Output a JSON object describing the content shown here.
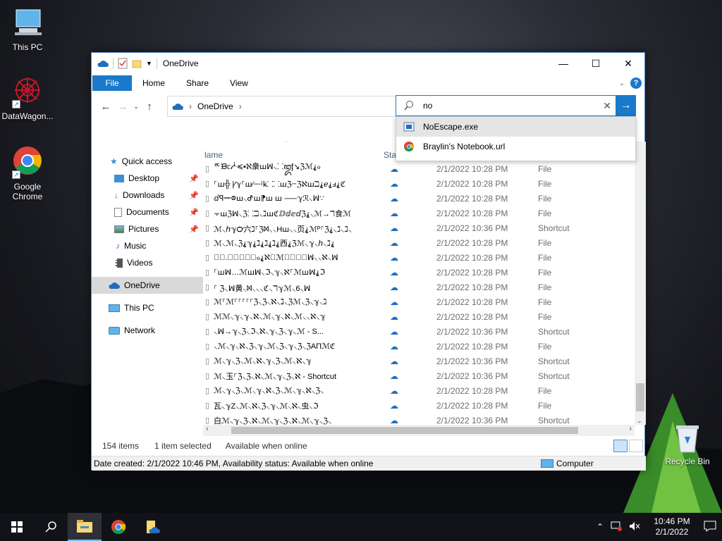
{
  "desktop": {
    "icons": [
      {
        "label": "This PC",
        "icon": "computer-icon"
      },
      {
        "label": "DataWagon...",
        "icon": "mandala-app-icon"
      },
      {
        "label": "Google Chrome",
        "icon": "chrome-icon"
      },
      {
        "label": "Recycle Bin",
        "icon": "recycle-bin-icon"
      }
    ]
  },
  "window": {
    "title": "OneDrive",
    "ribbon_tabs": [
      "File",
      "Home",
      "Share",
      "View"
    ],
    "address": {
      "location": "OneDrive"
    },
    "search": {
      "value": "no"
    },
    "suggestions": [
      {
        "label": "NoEscape.exe",
        "icon": "exe-icon"
      },
      {
        "label": "Braylin's Notebook.url",
        "icon": "chrome-icon"
      }
    ],
    "nav": {
      "quick_access": "Quick access",
      "items": [
        "Desktop",
        "Downloads",
        "Documents",
        "Pictures",
        "Music",
        "Videos"
      ],
      "onedrive": "OneDrive",
      "this_pc": "This PC",
      "network": "Network"
    },
    "columns": {
      "name": "lame",
      "status": "Stal"
    },
    "files": [
      {
        "name": "ꥦᙖᥴᓿ≼▪ℵ衆ꟺꟽ⸜⸬ꦈᶂ↘ℨℳ⸘ℴ",
        "date": "2/1/2022 10:28 PM",
        "type": "File"
      },
      {
        "name": "⸀ꟺ╬ |⁄ℽ⸀ꟺ⁄ᅳꜟꝃ⸬⸬ꟺℨⵈℨℵꟺℶ⸘ℯ⸘ⅎ⸘ℭ",
        "date": "2/1/2022 10:28 PM",
        "type": "File"
      },
      {
        "name": "ⅆꟼᆖ᳂ꟺ⸜ᕷꟺ⁋ꟺ ꟺ ⸺ℽℛ⸜ꟽ∵",
        "date": "2/1/2022 10:28 PM",
        "type": "File"
      },
      {
        "name": "⸟ꟺℨꟽ⸜ℨ⸬ℶ⸜ℷꟺℭⅅⅆⅇⅆℨ⸘⸜ℳ→ℸ食ℳ",
        "date": "2/1/2022 10:28 PM",
        "type": "File"
      },
      {
        "name": "ℳ⸜ℎℽ℺六ℷ⸀ℨᢂ⸜⸜Hꟺ⸜⸜页⸘ℳᴾ⸀ℨ⸘⸜ℷ⸜ℷ⸜",
        "date": "2/1/2022 10:36 PM",
        "type": "Shortcut"
      },
      {
        "name": "ℳ⸜ℳ⸜ℨ⸘ℽ⸘ℷ⸘ℷ⸘ℷ⸘西⸘ℨℳ⸜ℽ⸜ℎ⸜ℷ⸘",
        "date": "2/1/2022 10:28 PM",
        "type": "File"
      },
      {
        "name": "⸀⸀.⸀⸀⸜ꦿ⸜ℴ⸘ℵ⸀ℳ⸜⸜⸜⸜ꟽ⸜⸜ℵ⸜ꟽ",
        "date": "2/1/2022 10:28 PM",
        "type": "File"
      },
      {
        "name": "⸀ꟺꟽ…ℳꟺꟽ⸜ℑ⸜ℽ⸜ℵ⸀ℳꟺꟽ⸘ℑ",
        "date": "2/1/2022 10:28 PM",
        "type": "File"
      },
      {
        "name": "⸀ ℨ⸜ꟽ黄⸜ᢂ⸜⸜⸜ℭ⸜ℸℽℳ⸜6⸜ꟽ",
        "date": "2/1/2022 10:28 PM",
        "type": "File"
      },
      {
        "name": "ℳ⸀ℳ⸀⸀⸀⸀⸀ℨ⸜ℨ⸜ℵ⸜ℷ⸜ℨℳ⸜ℨ⸜ℽ⸜ℷ",
        "date": "2/1/2022 10:28 PM",
        "type": "File"
      },
      {
        "name": "ℳℳ⸜ℽ⸜ℽ⸜ℵ⸜ℳ⸜ℽ⸜ℵ⸜ℳ⸜⸜ℵ⸜ℽ",
        "date": "2/1/2022 10:28 PM",
        "type": "File"
      },
      {
        "name": "⸜ꟽ→ℽ⸜ℨ⸜ℑ⸜ℵ⸜ℽ⸜ℨ⸜ℽ⸜ℳ - S...",
        "date": "2/1/2022 10:36 PM",
        "type": "Shortcut"
      },
      {
        "name": "⸜ℳ⸜ℽ⸜ℵ⸜ℨ⸜ℽ⸜ℳ⸜ℨ⸜ℽ⸜ℨ⸜ℨAΠℳℭ",
        "date": "2/1/2022 10:28 PM",
        "type": "File"
      },
      {
        "name": "ℳ⸜ℽ⸜ℨ⸜ℳ⸜ℵ⸜ℽ⸜ℨ⸜ℳ⸜ℵ⸜ℽ",
        "date": "2/1/2022 10:36 PM",
        "type": "Shortcut"
      },
      {
        "name": "ℳ⸜玉⸀ℨ⸜ℨ⸜ℵ⸜ℳ⸜ℽ⸜ℨ⸜ℵ - Shortcut",
        "date": "2/1/2022 10:36 PM",
        "type": "Shortcut"
      },
      {
        "name": "ℳ⸜ℽ⸜ℨ⸜ℳ⸜ℽ⸜ℵ⸜ℨ⸜ℳ⸜ℽ⸜ℵ⸜ℨ⸜",
        "date": "2/1/2022 10:28 PM",
        "type": "File"
      },
      {
        "name": "瓦⸜ℽZ⸜ℳ⸜ℵ⸜ℨ⸜ℽ⸜ℳ⸜ℵ⸜虫⸜ℑ",
        "date": "2/1/2022 10:28 PM",
        "type": "File"
      },
      {
        "name": "白ℳ⸜ℽ⸜ℨ⸜ℵ⸜ℳ⸜ℽ⸜ℨ⸜ℵ⸜ℳ⸜ℽ⸜ℨ⸜",
        "date": "2/1/2022 10:36 PM",
        "type": "Shortcut"
      }
    ],
    "status": {
      "count": "154 items",
      "selected": "1 item selected",
      "availability": "Available when online"
    },
    "details": {
      "text": "Date created: 2/1/2022 10:46 PM, Availability status: Available when online",
      "location": "Computer"
    }
  },
  "taskbar": {
    "time": "10:46 PM",
    "date": "2/1/2022"
  },
  "colors": {
    "accent": "#1979ca",
    "cloud": "#1f6fc1"
  }
}
